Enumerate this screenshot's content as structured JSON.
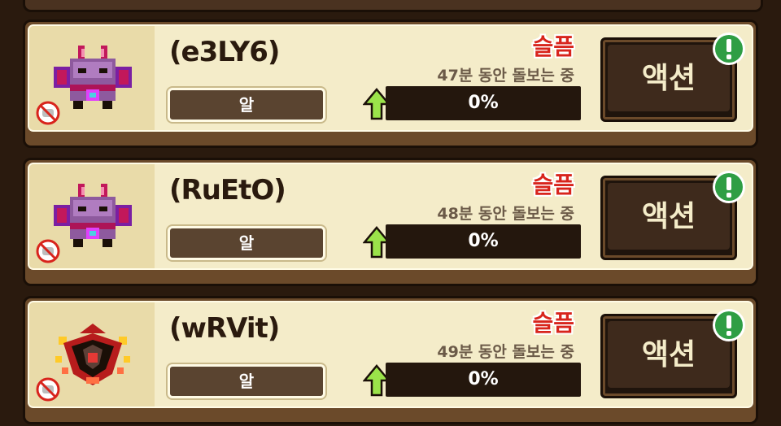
{
  "colors": {
    "mood_red": "#d8241c",
    "progress_track": "#24170d",
    "action_face": "#3e2a1c",
    "card_bg": "#f4ecc9",
    "alert_green": "#2f9e44"
  },
  "pets": [
    {
      "name": "(e3LY6)",
      "stage": "알",
      "mood": "슬픔",
      "care_text": "47분 동안 돌보는 중",
      "progress_label": "0%",
      "progress": 0,
      "action_label": "액션",
      "sprite": "dragon-purple-icon"
    },
    {
      "name": "(RuEtO)",
      "stage": "알",
      "mood": "슬픔",
      "care_text": "48분 동안 돌보는 중",
      "progress_label": "0%",
      "progress": 0,
      "action_label": "액션",
      "sprite": "dragon-purple-icon"
    },
    {
      "name": "(wRVit)",
      "stage": "알",
      "mood": "슬픔",
      "care_text": "49분 동안 돌보는 중",
      "progress_label": "0%",
      "progress": 0,
      "action_label": "액션",
      "sprite": "dragon-red-icon"
    }
  ]
}
